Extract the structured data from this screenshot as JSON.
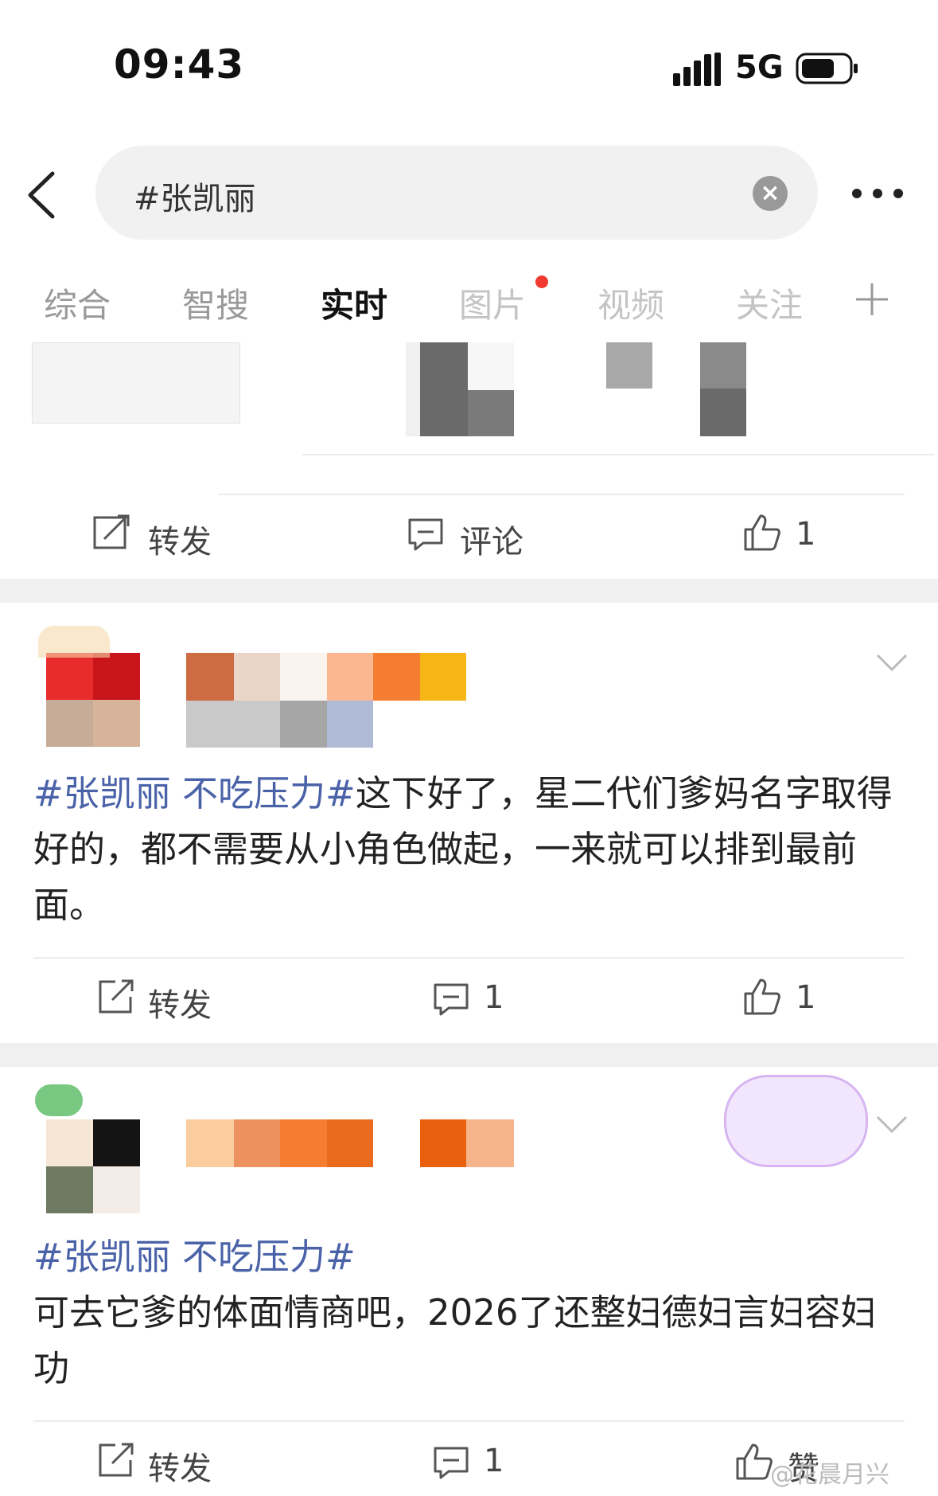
{
  "status_bar": {
    "time": "09:43",
    "network": "5G"
  },
  "header": {
    "search_query": "#张凯丽"
  },
  "tabs": [
    "综合",
    "智搜",
    "实时",
    "图片",
    "视频",
    "关注"
  ],
  "post0": {
    "repost_label": "转发",
    "comment_label": "评论",
    "like_count": "1"
  },
  "post1": {
    "hashtag": "#张凯丽 不吃压力#",
    "text": "这下好了，星二代们爹妈名字取得好的，都不需要从小角色做起，一来就可以排到最前面。",
    "repost_label": "转发",
    "comment_count": "1",
    "like_count": "1"
  },
  "post2": {
    "hashtag": "#张凯丽 不吃压力#",
    "text": "可去它爹的体面情商吧，2026了还整妇德妇言妇容妇功",
    "repost_label": "转发",
    "comment_count": "1",
    "like_label": "赞"
  },
  "watermark": "@花晨月兴",
  "colors": {
    "hashtag": "#4a62a8",
    "tab_dot": "#f23b30",
    "active_tab": "#111111",
    "inactive_tab": "#9a9a9a"
  },
  "icons": [
    "back-arrow-icon",
    "clear-icon",
    "more-icon",
    "plus-icon",
    "repost-icon",
    "comment-icon",
    "like-icon",
    "chevron-down-icon"
  ]
}
